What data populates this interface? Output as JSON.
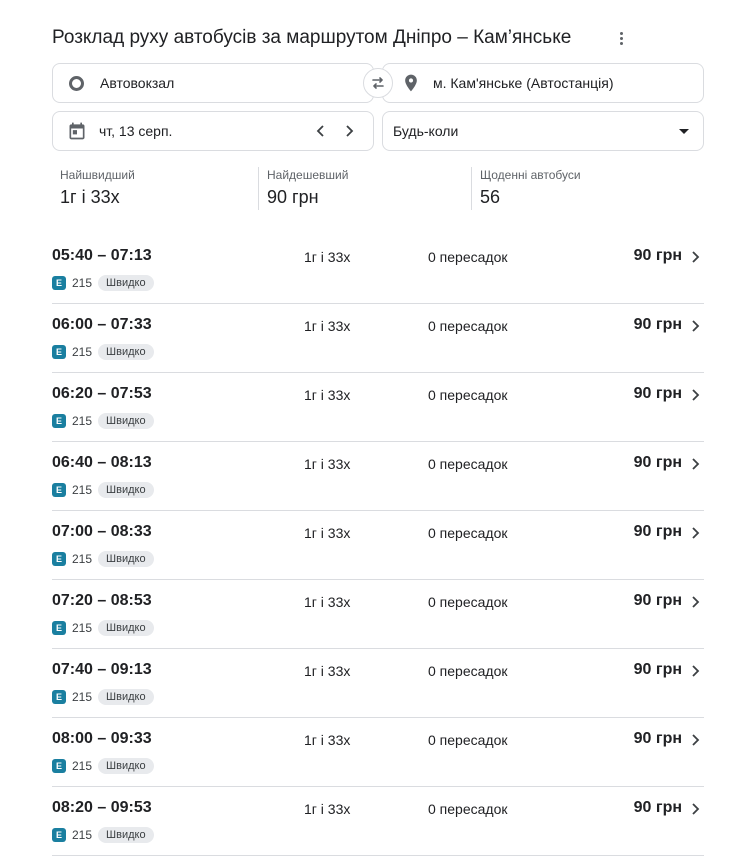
{
  "header": {
    "title": "Розклад руху автобусів за маршрутом Дніпро – Кам’янське"
  },
  "search": {
    "origin": "Автовокзал",
    "destination": "м. Кам'янське (Автостанція)",
    "date": "чт, 13 серп.",
    "time": "Будь-коли"
  },
  "stats": [
    {
      "label": "Найшвидший",
      "value": "1г і 33х"
    },
    {
      "label": "Найдешевший",
      "value": "90 грн"
    },
    {
      "label": "Щоденні автобуси",
      "value": "56"
    }
  ],
  "trips": [
    {
      "times": "05:40 – 07:13",
      "duration": "1г і 33х",
      "transfers": "0 пересадок",
      "price": "90 грн",
      "operator_logo": "E",
      "route": "215",
      "badge": "Швидко"
    },
    {
      "times": "06:00 – 07:33",
      "duration": "1г і 33х",
      "transfers": "0 пересадок",
      "price": "90 грн",
      "operator_logo": "E",
      "route": "215",
      "badge": "Швидко"
    },
    {
      "times": "06:20 – 07:53",
      "duration": "1г і 33х",
      "transfers": "0 пересадок",
      "price": "90 грн",
      "operator_logo": "E",
      "route": "215",
      "badge": "Швидко"
    },
    {
      "times": "06:40 – 08:13",
      "duration": "1г і 33х",
      "transfers": "0 пересадок",
      "price": "90 грн",
      "operator_logo": "E",
      "route": "215",
      "badge": "Швидко"
    },
    {
      "times": "07:00 – 08:33",
      "duration": "1г і 33х",
      "transfers": "0 пересадок",
      "price": "90 грн",
      "operator_logo": "E",
      "route": "215",
      "badge": "Швидко"
    },
    {
      "times": "07:20 – 08:53",
      "duration": "1г і 33х",
      "transfers": "0 пересадок",
      "price": "90 грн",
      "operator_logo": "E",
      "route": "215",
      "badge": "Швидко"
    },
    {
      "times": "07:40 – 09:13",
      "duration": "1г і 33х",
      "transfers": "0 пересадок",
      "price": "90 грн",
      "operator_logo": "E",
      "route": "215",
      "badge": "Швидко"
    },
    {
      "times": "08:00 – 09:33",
      "duration": "1г і 33х",
      "transfers": "0 пересадок",
      "price": "90 грн",
      "operator_logo": "E",
      "route": "215",
      "badge": "Швидко"
    },
    {
      "times": "08:20 – 09:53",
      "duration": "1г і 33х",
      "transfers": "0 пересадок",
      "price": "90 грн",
      "operator_logo": "E",
      "route": "215",
      "badge": "Швидко"
    }
  ],
  "icons": {
    "more": "more-vert-icon",
    "origin": "circle-icon",
    "destination": "location-pin-icon",
    "swap": "swap-arrows-icon",
    "calendar": "calendar-icon",
    "prev": "chevron-left-icon",
    "next": "chevron-right-icon",
    "dropdown": "caret-down-icon"
  },
  "colors": {
    "operator_logo": "#1a7fa0",
    "border": "#dadce0",
    "badge_bg": "#e8eaed"
  }
}
